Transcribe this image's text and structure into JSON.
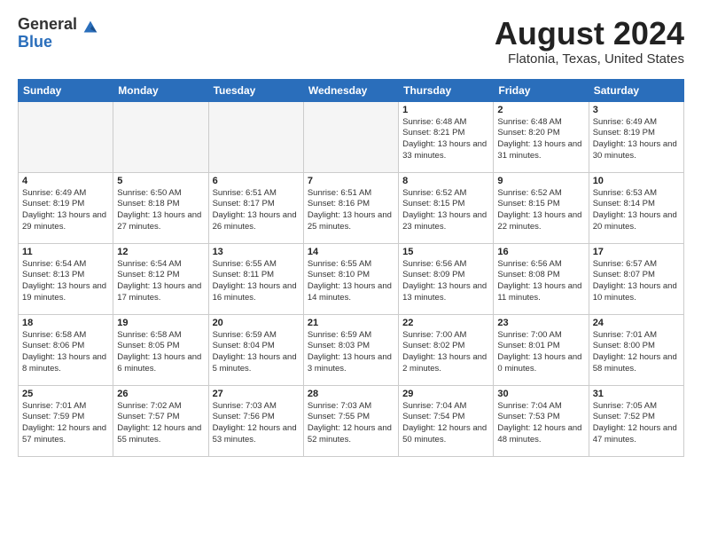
{
  "header": {
    "logo_general": "General",
    "logo_blue": "Blue",
    "title": "August 2024",
    "subtitle": "Flatonia, Texas, United States"
  },
  "weekdays": [
    "Sunday",
    "Monday",
    "Tuesday",
    "Wednesday",
    "Thursday",
    "Friday",
    "Saturday"
  ],
  "weeks": [
    [
      {
        "day": "",
        "empty": true
      },
      {
        "day": "",
        "empty": true
      },
      {
        "day": "",
        "empty": true
      },
      {
        "day": "",
        "empty": true
      },
      {
        "day": "1",
        "sunrise": "6:48 AM",
        "sunset": "8:21 PM",
        "daylight": "13 hours and 33 minutes."
      },
      {
        "day": "2",
        "sunrise": "6:48 AM",
        "sunset": "8:20 PM",
        "daylight": "13 hours and 31 minutes."
      },
      {
        "day": "3",
        "sunrise": "6:49 AM",
        "sunset": "8:19 PM",
        "daylight": "13 hours and 30 minutes."
      }
    ],
    [
      {
        "day": "4",
        "sunrise": "6:49 AM",
        "sunset": "8:19 PM",
        "daylight": "13 hours and 29 minutes."
      },
      {
        "day": "5",
        "sunrise": "6:50 AM",
        "sunset": "8:18 PM",
        "daylight": "13 hours and 27 minutes."
      },
      {
        "day": "6",
        "sunrise": "6:51 AM",
        "sunset": "8:17 PM",
        "daylight": "13 hours and 26 minutes."
      },
      {
        "day": "7",
        "sunrise": "6:51 AM",
        "sunset": "8:16 PM",
        "daylight": "13 hours and 25 minutes."
      },
      {
        "day": "8",
        "sunrise": "6:52 AM",
        "sunset": "8:15 PM",
        "daylight": "13 hours and 23 minutes."
      },
      {
        "day": "9",
        "sunrise": "6:52 AM",
        "sunset": "8:15 PM",
        "daylight": "13 hours and 22 minutes."
      },
      {
        "day": "10",
        "sunrise": "6:53 AM",
        "sunset": "8:14 PM",
        "daylight": "13 hours and 20 minutes."
      }
    ],
    [
      {
        "day": "11",
        "sunrise": "6:54 AM",
        "sunset": "8:13 PM",
        "daylight": "13 hours and 19 minutes."
      },
      {
        "day": "12",
        "sunrise": "6:54 AM",
        "sunset": "8:12 PM",
        "daylight": "13 hours and 17 minutes."
      },
      {
        "day": "13",
        "sunrise": "6:55 AM",
        "sunset": "8:11 PM",
        "daylight": "13 hours and 16 minutes."
      },
      {
        "day": "14",
        "sunrise": "6:55 AM",
        "sunset": "8:10 PM",
        "daylight": "13 hours and 14 minutes."
      },
      {
        "day": "15",
        "sunrise": "6:56 AM",
        "sunset": "8:09 PM",
        "daylight": "13 hours and 13 minutes."
      },
      {
        "day": "16",
        "sunrise": "6:56 AM",
        "sunset": "8:08 PM",
        "daylight": "13 hours and 11 minutes."
      },
      {
        "day": "17",
        "sunrise": "6:57 AM",
        "sunset": "8:07 PM",
        "daylight": "13 hours and 10 minutes."
      }
    ],
    [
      {
        "day": "18",
        "sunrise": "6:58 AM",
        "sunset": "8:06 PM",
        "daylight": "13 hours and 8 minutes."
      },
      {
        "day": "19",
        "sunrise": "6:58 AM",
        "sunset": "8:05 PM",
        "daylight": "13 hours and 6 minutes."
      },
      {
        "day": "20",
        "sunrise": "6:59 AM",
        "sunset": "8:04 PM",
        "daylight": "13 hours and 5 minutes."
      },
      {
        "day": "21",
        "sunrise": "6:59 AM",
        "sunset": "8:03 PM",
        "daylight": "13 hours and 3 minutes."
      },
      {
        "day": "22",
        "sunrise": "7:00 AM",
        "sunset": "8:02 PM",
        "daylight": "13 hours and 2 minutes."
      },
      {
        "day": "23",
        "sunrise": "7:00 AM",
        "sunset": "8:01 PM",
        "daylight": "13 hours and 0 minutes."
      },
      {
        "day": "24",
        "sunrise": "7:01 AM",
        "sunset": "8:00 PM",
        "daylight": "12 hours and 58 minutes."
      }
    ],
    [
      {
        "day": "25",
        "sunrise": "7:01 AM",
        "sunset": "7:59 PM",
        "daylight": "12 hours and 57 minutes."
      },
      {
        "day": "26",
        "sunrise": "7:02 AM",
        "sunset": "7:57 PM",
        "daylight": "12 hours and 55 minutes."
      },
      {
        "day": "27",
        "sunrise": "7:03 AM",
        "sunset": "7:56 PM",
        "daylight": "12 hours and 53 minutes."
      },
      {
        "day": "28",
        "sunrise": "7:03 AM",
        "sunset": "7:55 PM",
        "daylight": "12 hours and 52 minutes."
      },
      {
        "day": "29",
        "sunrise": "7:04 AM",
        "sunset": "7:54 PM",
        "daylight": "12 hours and 50 minutes."
      },
      {
        "day": "30",
        "sunrise": "7:04 AM",
        "sunset": "7:53 PM",
        "daylight": "12 hours and 48 minutes."
      },
      {
        "day": "31",
        "sunrise": "7:05 AM",
        "sunset": "7:52 PM",
        "daylight": "12 hours and 47 minutes."
      }
    ]
  ]
}
